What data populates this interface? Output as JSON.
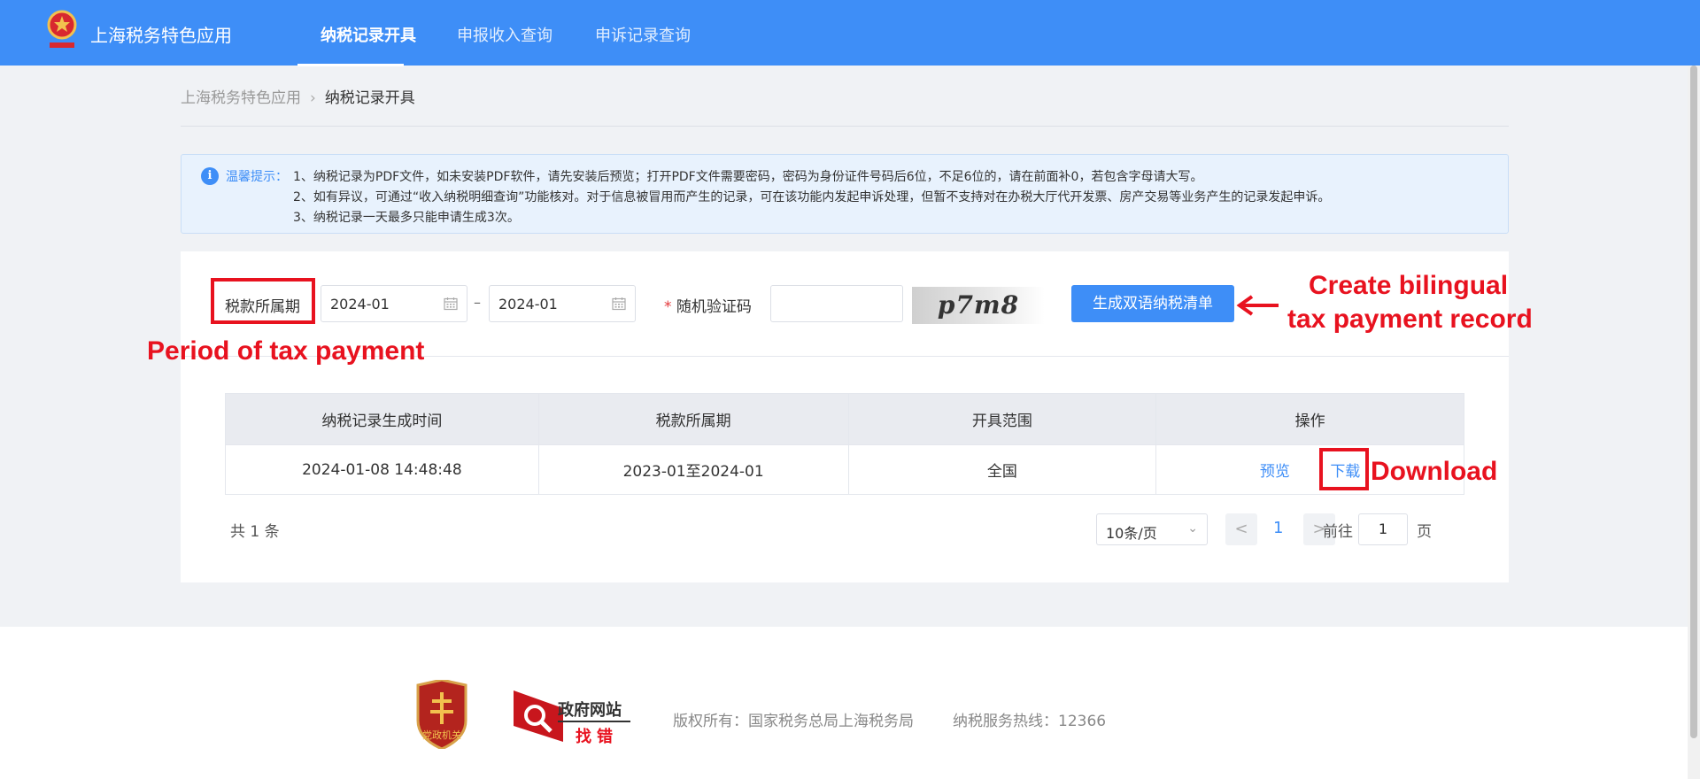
{
  "header": {
    "app_title": "上海税务特色应用",
    "nav": [
      "纳税记录开具",
      "申报收入查询",
      "申诉记录查询"
    ]
  },
  "breadcrumb": {
    "root": "上海税务特色应用",
    "current": "纳税记录开具"
  },
  "notice": {
    "label": "温馨提示：",
    "lines": [
      "1、纳税记录为PDF文件，如未安装PDF软件，请先安装后预览；打开PDF文件需要密码，密码为身份证件号码后6位，不足6位的，请在前面补0，若包含字母请大写。",
      "2、如有异议，可通过“收入纳税明细查询”功能核对。对于信息被冒用而产生的记录，可在该功能内发起申诉处理，但暂不支持对在办税大厅代开发票、房产交易等业务产生的记录发起申诉。",
      "3、纳税记录一天最多只能申请生成3次。"
    ]
  },
  "form": {
    "period_label": "税款所属期",
    "start_date": "2024-01",
    "end_date": "2024-01",
    "range_separator": "–",
    "required_mark": "*",
    "captcha_label": "随机验证码",
    "captcha_value": "",
    "captcha_image_text": "p7m8",
    "generate_button": "生成双语纳税清单"
  },
  "table": {
    "headers": [
      "纳税记录生成时间",
      "税款所属期",
      "开具范围",
      "操作"
    ],
    "rows": [
      {
        "generated_time": "2024-01-08 14:48:48",
        "period": "2023-01至2024-01",
        "scope": "全国",
        "preview": "预览",
        "download": "下载"
      }
    ]
  },
  "pagination": {
    "total": "共 1 条",
    "page_size": "10条/页",
    "prev": "<",
    "current_page": "1",
    "next": ">",
    "goto_prefix": "前往",
    "goto_value": "1",
    "goto_suffix": "页"
  },
  "annotations": {
    "period": "Period of tax payment",
    "create_line1": "Create bilingual",
    "create_line2": "tax payment record",
    "download": "Download"
  },
  "footer": {
    "badge_text": "党政机关",
    "gov_title": "政府网站",
    "gov_sub": "找错",
    "copyright": "版权所有：国家税务总局上海税务局",
    "hotline": "纳税服务热线：12366"
  },
  "colors": {
    "primary": "#3e8ef7",
    "annotation": "#e8121f",
    "background": "#f0f2f5"
  }
}
